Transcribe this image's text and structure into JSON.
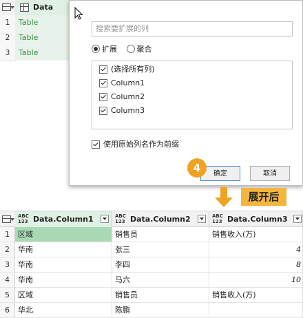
{
  "source_table": {
    "column_label": "Data",
    "rows": [
      {
        "num": "1",
        "value": "Table"
      },
      {
        "num": "2",
        "value": "Table"
      },
      {
        "num": "3",
        "value": "Table"
      }
    ]
  },
  "dialog": {
    "search_placeholder": "搜索要扩展的列",
    "radio_expand": "扩展",
    "radio_aggregate": "聚合",
    "items": [
      {
        "label": "(选择所有列)"
      },
      {
        "label": "Column1"
      },
      {
        "label": "Column2"
      },
      {
        "label": "Column3"
      }
    ],
    "prefix_label": "使用原始列名作为前缀",
    "ok_label": "确定",
    "cancel_label": "取消"
  },
  "step_number": "4",
  "after_label": "展开后",
  "result_table": {
    "type_icon_top": "ABC",
    "type_icon_bottom": "123",
    "columns": [
      {
        "label": "Data.Column1"
      },
      {
        "label": "Data.Column2"
      },
      {
        "label": "Data.Column3"
      }
    ],
    "rows": [
      {
        "num": "1",
        "c1": "区域",
        "c2": "销售员",
        "c3": "销售收入(万)"
      },
      {
        "num": "2",
        "c1": "华南",
        "c2": "张三",
        "c3": "4"
      },
      {
        "num": "3",
        "c1": "华南",
        "c2": "李四",
        "c3": "8"
      },
      {
        "num": "4",
        "c1": "华南",
        "c2": "马六",
        "c3": "10"
      },
      {
        "num": "5",
        "c1": "区域",
        "c2": "销售员",
        "c3": "销售收入(万)"
      },
      {
        "num": "6",
        "c1": "华北",
        "c2": "陈鹏",
        "c3": ""
      }
    ]
  },
  "colors": {
    "accent_orange": "#f0a322",
    "label_bg": "#f3b63d",
    "selected_cell": "#a9d8b5",
    "table_green_text": "#3a8a46"
  }
}
